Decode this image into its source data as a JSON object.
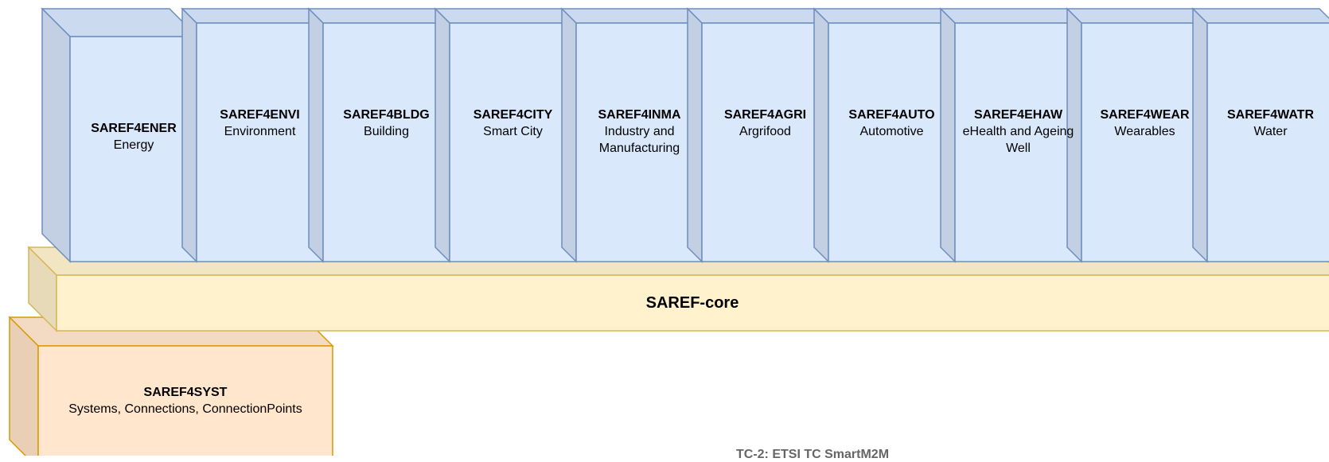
{
  "colors": {
    "ext_front": "#dae8fc",
    "ext_side": "#c3cfe2",
    "ext_top": "#ccdaf0",
    "ext_stroke": "#6c8ebf",
    "core_front": "#fff2cc",
    "core_side": "#e6dab8",
    "core_top": "#f2e6c2",
    "core_stroke": "#d6b656",
    "syst_front": "#ffe6cc",
    "syst_side": "#e8cfb5",
    "syst_top": "#f2dbc2",
    "syst_stroke": "#d79b00"
  },
  "extensions": [
    {
      "code": "SAREF4ENER",
      "desc": "Energy"
    },
    {
      "code": "SAREF4ENVI",
      "desc": "Environment"
    },
    {
      "code": "SAREF4BLDG",
      "desc": "Building"
    },
    {
      "code": "SAREF4CITY",
      "desc": "Smart City"
    },
    {
      "code": "SAREF4INMA",
      "desc": "Industry and Manufacturing"
    },
    {
      "code": "SAREF4AGRI",
      "desc": "Argrifood"
    },
    {
      "code": "SAREF4AUTO",
      "desc": "Automotive"
    },
    {
      "code": "SAREF4EHAW",
      "desc": "eHealth and Ageing Well"
    },
    {
      "code": "SAREF4WEAR",
      "desc": "Wearables"
    },
    {
      "code": "SAREF4WATR",
      "desc": "Water"
    }
  ],
  "core": {
    "label": "SAREF-core"
  },
  "syst": {
    "code": "SAREF4SYST",
    "desc": "Systems, Connections, ConnectionPoints"
  },
  "footer": {
    "text": "TC-2: ETSI TC SmartM2M"
  }
}
